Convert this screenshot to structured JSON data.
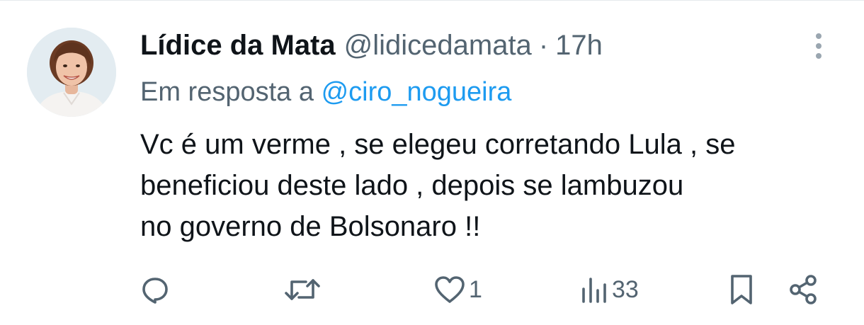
{
  "tweet": {
    "author": {
      "display_name": "Lídice da Mata",
      "handle": "@lidicedamata"
    },
    "separator": "·",
    "time": "17h",
    "reply_context": {
      "prefix": "Em resposta a",
      "mention": "@ciro_nogueira"
    },
    "text_lines": [
      "Vc é um verme , se elegeu corretando Lula , se",
      "beneficiou deste lado , depois se lambuzou",
      "no governo de Bolsonaro !!"
    ],
    "actions": {
      "reply": {
        "icon": "reply-icon",
        "count": ""
      },
      "retweet": {
        "icon": "retweet-icon",
        "count": ""
      },
      "like": {
        "icon": "heart-icon",
        "count": "1"
      },
      "views": {
        "icon": "views-icon",
        "count": "33"
      },
      "bookmark": {
        "icon": "bookmark-icon"
      },
      "share": {
        "icon": "share-icon"
      }
    },
    "more_icon": "more-vertical-icon"
  },
  "colors": {
    "text_primary": "#0f1419",
    "text_secondary": "#536471",
    "accent": "#1d9bf0"
  }
}
